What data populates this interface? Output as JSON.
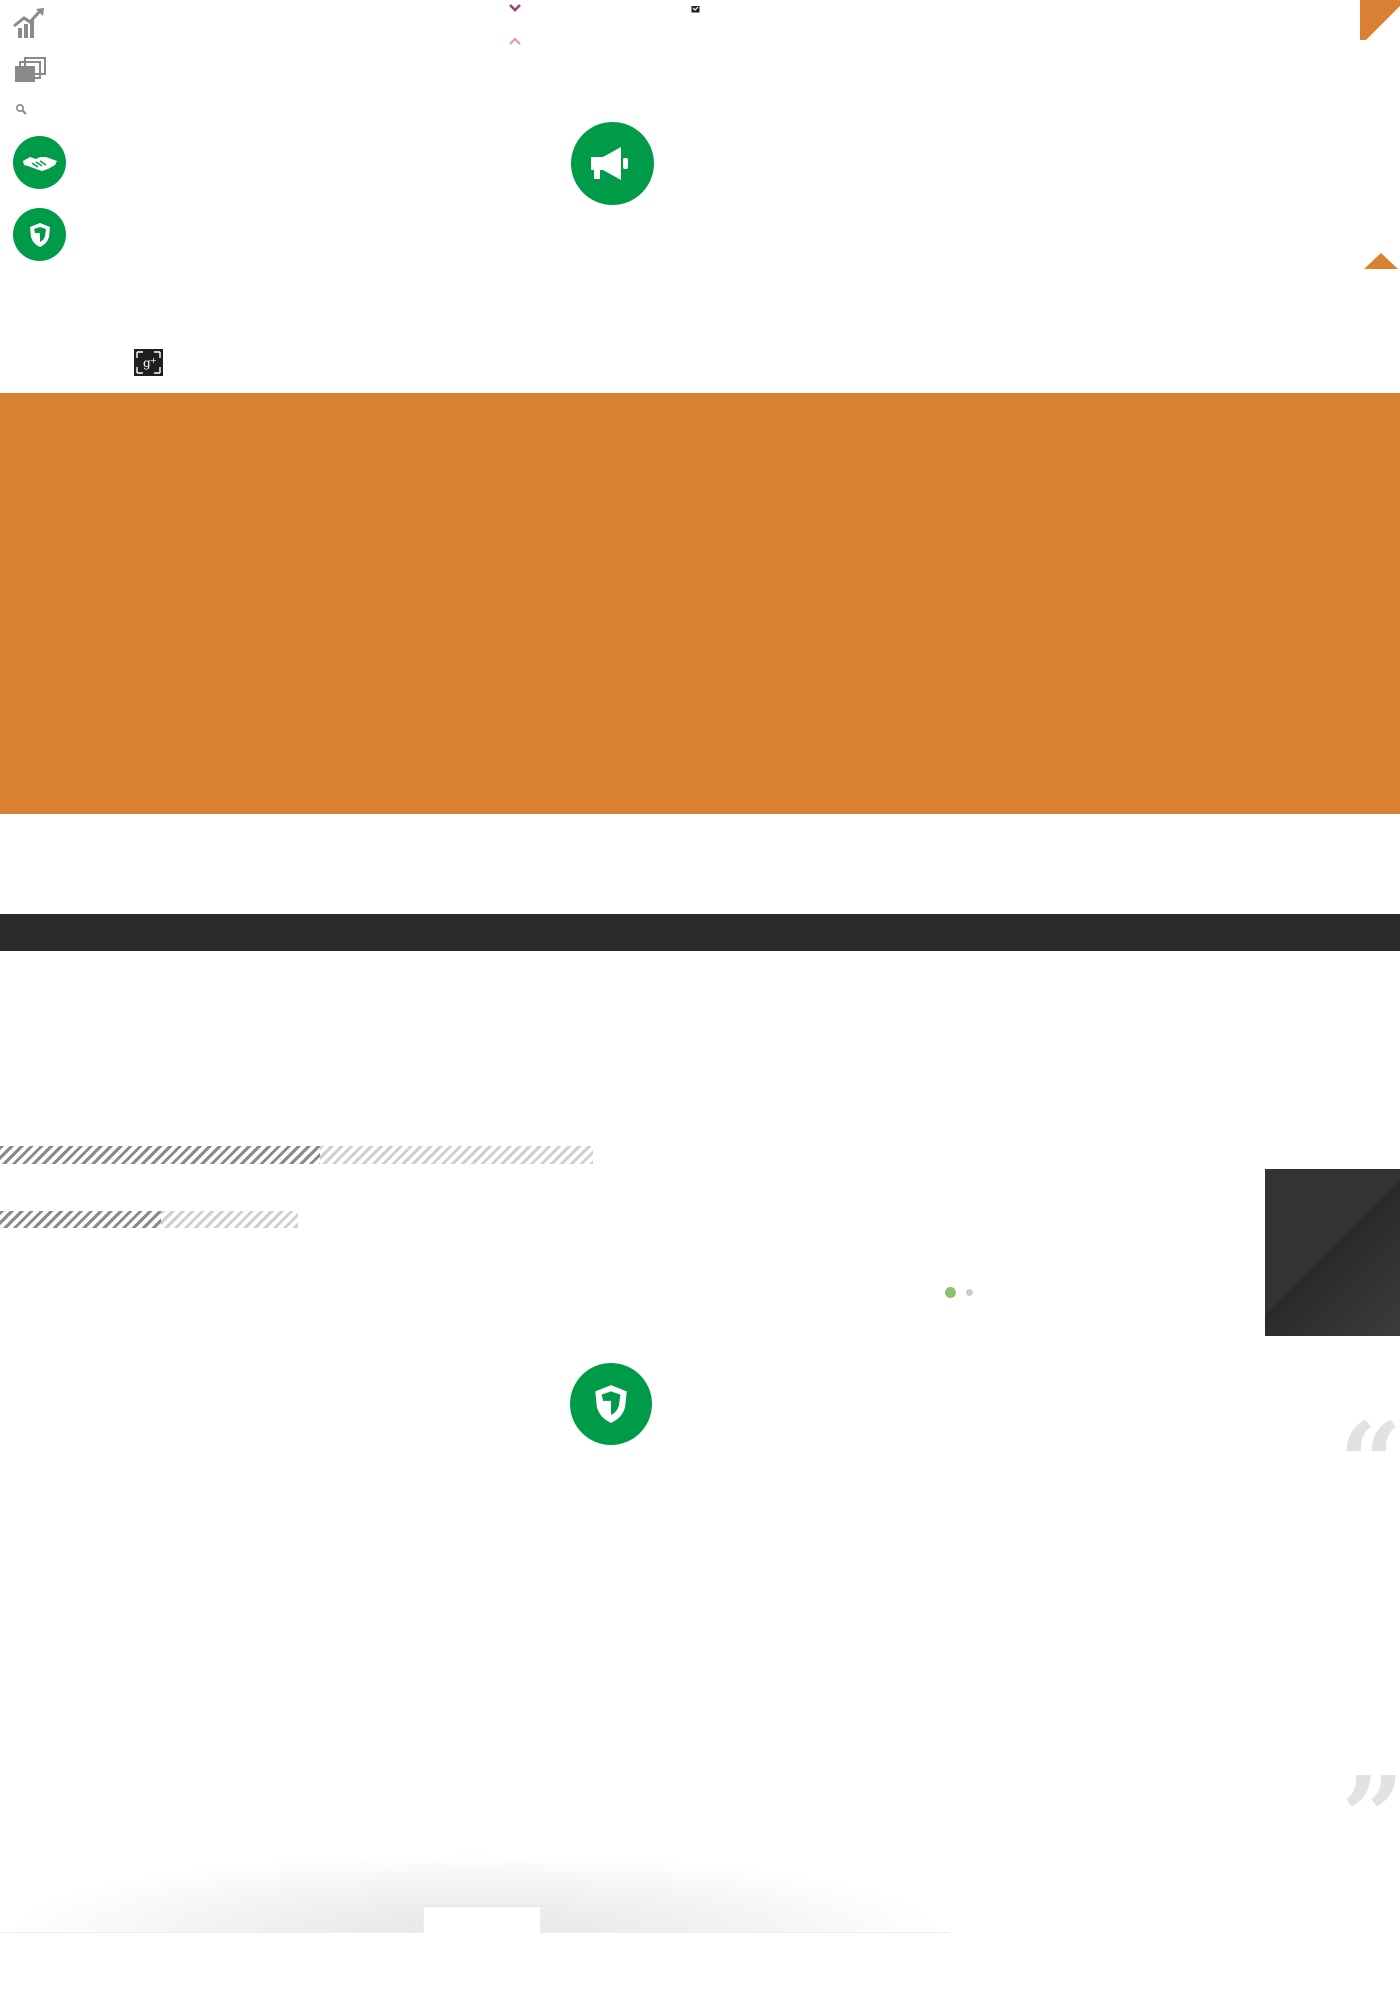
{
  "colors": {
    "brand_orange": "#d98032",
    "brand_green": "#009b48",
    "dark_band": "#2b2b2b",
    "icon_gray": "#8a8a8a",
    "chevron_purple": "#a0407a",
    "chevron_pink": "#d9a3c2",
    "dot_active": "#8dc26a",
    "dot_inactive": "#cccccc",
    "quote_gray": "#e2e2e2"
  },
  "icons": {
    "top_left": [
      "chart-growth-icon",
      "stack-icon",
      "search-icon"
    ],
    "left_circles": [
      "handshake-icon",
      "shield-icon"
    ],
    "center_top_circle": "megaphone-icon",
    "center_bottom_circle": "shield-icon",
    "social": "google-plus-icon",
    "chevrons": [
      "chevron-down-icon",
      "chevron-up-icon"
    ],
    "small_check": "checkbox-icon",
    "corner": "corner-triangle-icon",
    "scroll_top": "caret-up-icon",
    "quotes": [
      "quote-open-icon",
      "quote-close-icon"
    ]
  },
  "skills": {
    "bars": [
      {
        "name": "skill-bar-1",
        "fill_percent": 54
      },
      {
        "name": "skill-bar-2",
        "fill_percent": 54
      }
    ]
  },
  "slider": {
    "dots": 2,
    "active_index": 0
  },
  "quote": {
    "open_mark": "“",
    "close_mark": "”"
  }
}
